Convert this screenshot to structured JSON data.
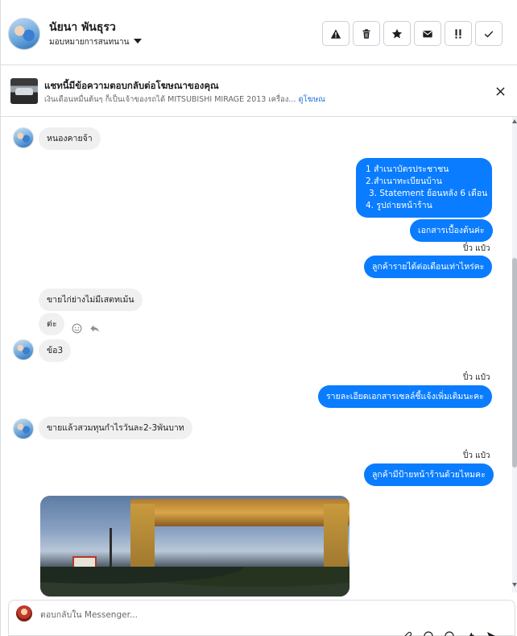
{
  "header": {
    "contact_name": "นัยนา พันธุรว",
    "assign_label": "มอบหมายการสนทนาน",
    "toolbar": [
      {
        "name": "report-button",
        "icon": "warning-icon"
      },
      {
        "name": "delete-button",
        "icon": "trash-icon"
      },
      {
        "name": "star-button",
        "icon": "star-icon"
      },
      {
        "name": "mark-unread-button",
        "icon": "envelope-icon"
      },
      {
        "name": "mark-spam-button",
        "icon": "exclamation-icon"
      },
      {
        "name": "mark-done-button",
        "icon": "check-icon"
      }
    ]
  },
  "ad": {
    "title": "แชทนี้มีข้อความตอบกลับต่อโฆษณาของคุณ",
    "subtitle": "เงินเดือนหมื่นต้นๆ ก็เป็นเจ้าของรถได้ MITSUBISHI MIRAGE 2013 เครื่อง...",
    "link": "ดูโฆษณา"
  },
  "messages": {
    "m1": "หนองคายจ้า",
    "m2_lines": [
      "1 สำเนาบัตรประชาชน",
      "2.สำเนาทะเบียนบ้าน",
      "3. Statement ย้อนหลัง 6 เดือน",
      "4. รูปถ่ายหน้าร้าน"
    ],
    "m3": "เอกสารเบื้องต้นค่ะ",
    "sender_out": "ปิ๋ว แป๋ว",
    "m4": "ลูกค้ารายได้ต่อเดือนเท่าไหร่คะ",
    "m5": "ขายไก่ย่างไม่มีเสตทเม้น",
    "m6": "ต่ะ",
    "m7": "ข้อ3",
    "m8": "รายละเอียดเอกสารเซลล์ชี้แจ้งเพิ่มเติมนะคะ",
    "m9": "ขายแล้วสวมทุนกำไรวันละ2-3พันบาท",
    "m10": "ลูกค้ามีป้ายหน้าร้านด้วยไหมคะ"
  },
  "composer": {
    "placeholder": "ตอบกลับใน Messenger..."
  },
  "colors": {
    "outgoing_bubble": "#0a7cff",
    "incoming_bubble": "#f0f0f0",
    "link": "#216fdb"
  }
}
